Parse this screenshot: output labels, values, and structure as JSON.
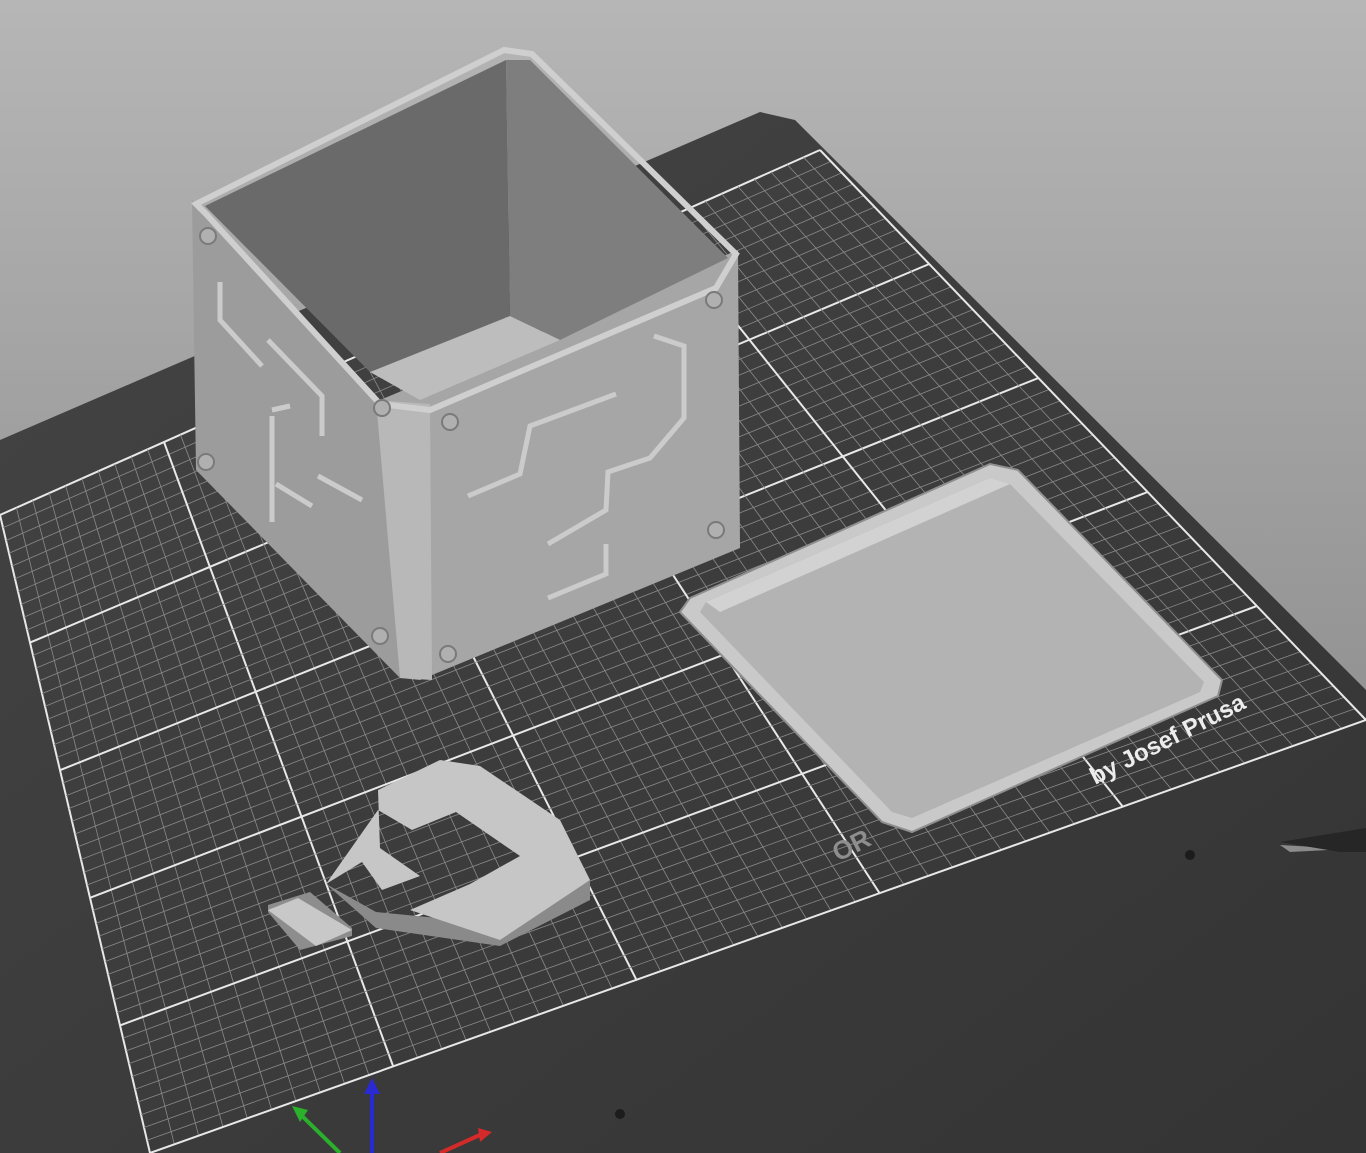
{
  "app": {
    "name": "3D print preparation viewport"
  },
  "bed": {
    "brand_text": "by Josef Prusa",
    "watermark_text": "OR"
  },
  "objects": [
    {
      "name": "question-block-box"
    },
    {
      "name": "box-lid"
    },
    {
      "name": "question-mark-piece"
    }
  ],
  "axes": [
    {
      "axis": "x",
      "color": "#d42a2a"
    },
    {
      "axis": "y",
      "color": "#2bb02b"
    },
    {
      "axis": "z",
      "color": "#2a2ad4"
    }
  ],
  "colors": {
    "background_top": "#b4b4b4",
    "background_bottom": "#7e7e7e",
    "bed": "#3a3a3a",
    "bed_edge": "#2a2a2a",
    "grid_minor": "#8a8a8a",
    "grid_major": "#e8e8e8",
    "model": "#a9a9a9"
  }
}
